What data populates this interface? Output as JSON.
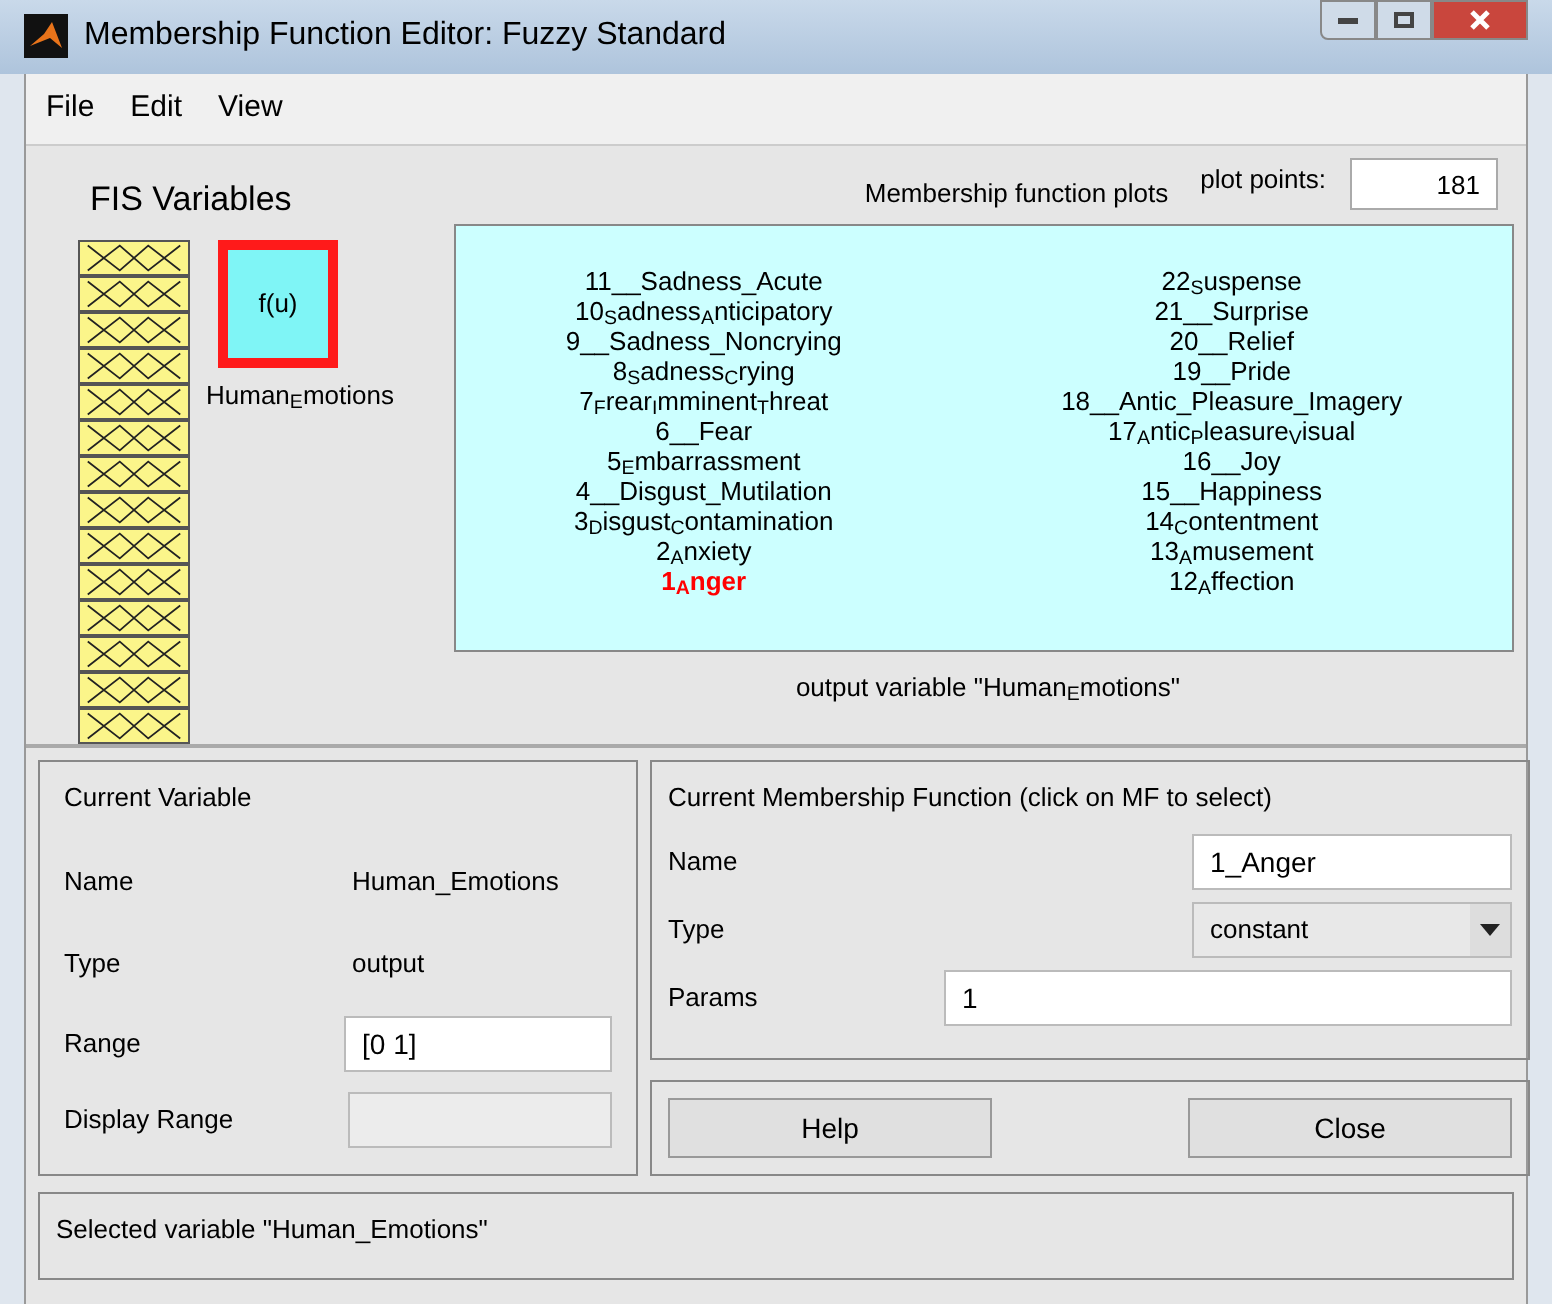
{
  "window": {
    "title": "Membership Function Editor: Fuzzy Standard"
  },
  "menu": [
    "File",
    "Edit",
    "View"
  ],
  "fis_variables": {
    "title": "FIS Variables",
    "inputs": [
      {
        "kind": "mf"
      },
      {
        "kind": "mf"
      },
      {
        "kind": "mf"
      },
      {
        "kind": "mf"
      },
      {
        "kind": "mf"
      },
      {
        "kind": "mf"
      },
      {
        "kind": "mf"
      },
      {
        "kind": "mf"
      },
      {
        "kind": "mf"
      },
      {
        "kind": "mf"
      },
      {
        "kind": "mf"
      },
      {
        "kind": "mf"
      },
      {
        "kind": "mf"
      },
      {
        "kind": "mf"
      }
    ],
    "output": {
      "label": "f(u)",
      "name": "Human$_{E}$motions",
      "selected": true
    }
  },
  "plot": {
    "title": "Membership function plots",
    "plot_points_label": "plot points:",
    "plot_points": "181",
    "left_labels": [
      {
        "text": "11__Sadness_Acute",
        "selected": false
      },
      {
        "text": "10$_{S}$adness$_{A}$nticipatory",
        "selected": false
      },
      {
        "text": "9__Sadness_Noncrying",
        "selected": false
      },
      {
        "text": "8$_{S}$adness$_{C}$rying",
        "selected": false
      },
      {
        "text": "7$_{F}$rear$_{I}$mminent$_{T}$hreat",
        "selected": false
      },
      {
        "text": "6__Fear",
        "selected": false
      },
      {
        "text": "5$_{E}$mbarrassment",
        "selected": false
      },
      {
        "text": "4__Disgust_Mutilation",
        "selected": false
      },
      {
        "text": "3$_{D}$isgust$_{C}$ontamination",
        "selected": false
      },
      {
        "text": "2$_{A}$nxiety",
        "selected": false
      },
      {
        "text": "1$_{A}$nger",
        "selected": true
      }
    ],
    "right_labels": [
      {
        "text": "22$_{S}$uspense",
        "selected": false
      },
      {
        "text": "21__Surprise",
        "selected": false
      },
      {
        "text": "20__Relief",
        "selected": false
      },
      {
        "text": "19__Pride",
        "selected": false
      },
      {
        "text": "18__Antic_Pleasure_Imagery",
        "selected": false
      },
      {
        "text": "17$_{A}$ntic$_{P}$leasure$_{V}$isual",
        "selected": false
      },
      {
        "text": "16__Joy",
        "selected": false
      },
      {
        "text": "15__Happiness",
        "selected": false
      },
      {
        "text": "14$_{C}$ontentment",
        "selected": false
      },
      {
        "text": "13$_{A}$musement",
        "selected": false
      },
      {
        "text": "12$_{A}$ffection",
        "selected": false
      }
    ],
    "caption": "output variable \"Human$_{E}$motions\""
  },
  "current_variable": {
    "title": "Current Variable",
    "name_label": "Name",
    "name": "Human_Emotions",
    "type_label": "Type",
    "type": "output",
    "range_label": "Range",
    "range": "[0 1]",
    "display_range_label": "Display Range"
  },
  "current_mf": {
    "title": "Current Membership Function (click on MF to select)",
    "name_label": "Name",
    "name": "1_Anger",
    "type_label": "Type",
    "type": "constant",
    "params_label": "Params",
    "params": "1"
  },
  "buttons": [
    "Help",
    "Close"
  ],
  "status": "Selected variable \"Human_Emotions\""
}
